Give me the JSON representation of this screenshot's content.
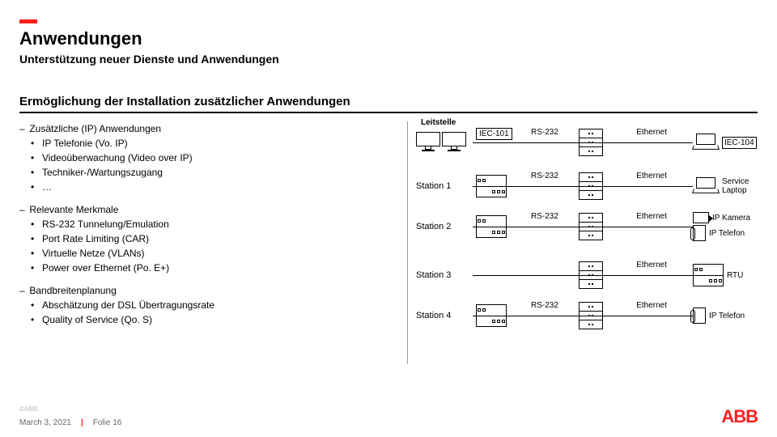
{
  "title": "Anwendungen",
  "subtitle": "Unterstützung neuer Dienste und Anwendungen",
  "section": "Ermöglichung der Installation zusätzlicher Anwendungen",
  "lists": [
    {
      "heading": "Zusätzliche (IP) Anwendungen",
      "items": [
        "IP Telefonie (Vo. IP)",
        "Videoüberwachung (Video over IP)",
        "Techniker-/Wartungszugang",
        "…"
      ]
    },
    {
      "heading": "Relevante Merkmale",
      "items": [
        "RS-232 Tunnelung/Emulation",
        "Port Rate Limiting (CAR)",
        "Virtuelle Netze (VLANs)",
        "Power over Ethernet (Po. E+)"
      ]
    },
    {
      "heading": "Bandbreitenplanung",
      "items": [
        "Abschätzung der DSL Übertragungsrate",
        "Quality of Service (Qo. S)"
      ]
    }
  ],
  "diagram": {
    "headerLabel": "Leitstelle",
    "topRow": {
      "left": "IEC-101",
      "mid": "RS-232",
      "right": "Ethernet",
      "end": "IEC-104"
    },
    "rows": [
      {
        "name": "Station 1",
        "mid": "RS-232",
        "right": "Ethernet",
        "end": "Service Laptop",
        "icon": "laptop"
      },
      {
        "name": "Station 2",
        "mid": "RS-232",
        "right": "Ethernet",
        "end": "IP Kamera",
        "end2": "IP Telefon",
        "icon": "camera-phone"
      },
      {
        "name": "Station 3",
        "mid": "",
        "right": "Ethernet",
        "end": "RTU",
        "icon": "rack"
      },
      {
        "name": "Station 4",
        "mid": "RS-232",
        "right": "Ethernet",
        "end": "IP Telefon",
        "icon": "phone"
      }
    ]
  },
  "footer": {
    "date": "March 3, 2021",
    "slide": "Folie 16",
    "copyright": "©ABB",
    "logo": "ABB"
  }
}
